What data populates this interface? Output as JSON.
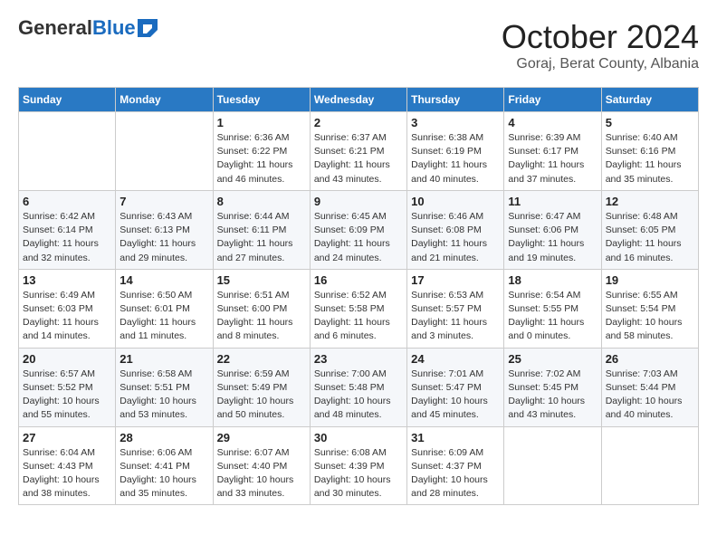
{
  "header": {
    "logo_general": "General",
    "logo_blue": "Blue",
    "month": "October 2024",
    "location": "Goraj, Berat County, Albania"
  },
  "weekdays": [
    "Sunday",
    "Monday",
    "Tuesday",
    "Wednesday",
    "Thursday",
    "Friday",
    "Saturday"
  ],
  "weeks": [
    [
      {
        "day": "",
        "info": ""
      },
      {
        "day": "",
        "info": ""
      },
      {
        "day": "1",
        "info": "Sunrise: 6:36 AM\nSunset: 6:22 PM\nDaylight: 11 hours and 46 minutes."
      },
      {
        "day": "2",
        "info": "Sunrise: 6:37 AM\nSunset: 6:21 PM\nDaylight: 11 hours and 43 minutes."
      },
      {
        "day": "3",
        "info": "Sunrise: 6:38 AM\nSunset: 6:19 PM\nDaylight: 11 hours and 40 minutes."
      },
      {
        "day": "4",
        "info": "Sunrise: 6:39 AM\nSunset: 6:17 PM\nDaylight: 11 hours and 37 minutes."
      },
      {
        "day": "5",
        "info": "Sunrise: 6:40 AM\nSunset: 6:16 PM\nDaylight: 11 hours and 35 minutes."
      }
    ],
    [
      {
        "day": "6",
        "info": "Sunrise: 6:42 AM\nSunset: 6:14 PM\nDaylight: 11 hours and 32 minutes."
      },
      {
        "day": "7",
        "info": "Sunrise: 6:43 AM\nSunset: 6:13 PM\nDaylight: 11 hours and 29 minutes."
      },
      {
        "day": "8",
        "info": "Sunrise: 6:44 AM\nSunset: 6:11 PM\nDaylight: 11 hours and 27 minutes."
      },
      {
        "day": "9",
        "info": "Sunrise: 6:45 AM\nSunset: 6:09 PM\nDaylight: 11 hours and 24 minutes."
      },
      {
        "day": "10",
        "info": "Sunrise: 6:46 AM\nSunset: 6:08 PM\nDaylight: 11 hours and 21 minutes."
      },
      {
        "day": "11",
        "info": "Sunrise: 6:47 AM\nSunset: 6:06 PM\nDaylight: 11 hours and 19 minutes."
      },
      {
        "day": "12",
        "info": "Sunrise: 6:48 AM\nSunset: 6:05 PM\nDaylight: 11 hours and 16 minutes."
      }
    ],
    [
      {
        "day": "13",
        "info": "Sunrise: 6:49 AM\nSunset: 6:03 PM\nDaylight: 11 hours and 14 minutes."
      },
      {
        "day": "14",
        "info": "Sunrise: 6:50 AM\nSunset: 6:01 PM\nDaylight: 11 hours and 11 minutes."
      },
      {
        "day": "15",
        "info": "Sunrise: 6:51 AM\nSunset: 6:00 PM\nDaylight: 11 hours and 8 minutes."
      },
      {
        "day": "16",
        "info": "Sunrise: 6:52 AM\nSunset: 5:58 PM\nDaylight: 11 hours and 6 minutes."
      },
      {
        "day": "17",
        "info": "Sunrise: 6:53 AM\nSunset: 5:57 PM\nDaylight: 11 hours and 3 minutes."
      },
      {
        "day": "18",
        "info": "Sunrise: 6:54 AM\nSunset: 5:55 PM\nDaylight: 11 hours and 0 minutes."
      },
      {
        "day": "19",
        "info": "Sunrise: 6:55 AM\nSunset: 5:54 PM\nDaylight: 10 hours and 58 minutes."
      }
    ],
    [
      {
        "day": "20",
        "info": "Sunrise: 6:57 AM\nSunset: 5:52 PM\nDaylight: 10 hours and 55 minutes."
      },
      {
        "day": "21",
        "info": "Sunrise: 6:58 AM\nSunset: 5:51 PM\nDaylight: 10 hours and 53 minutes."
      },
      {
        "day": "22",
        "info": "Sunrise: 6:59 AM\nSunset: 5:49 PM\nDaylight: 10 hours and 50 minutes."
      },
      {
        "day": "23",
        "info": "Sunrise: 7:00 AM\nSunset: 5:48 PM\nDaylight: 10 hours and 48 minutes."
      },
      {
        "day": "24",
        "info": "Sunrise: 7:01 AM\nSunset: 5:47 PM\nDaylight: 10 hours and 45 minutes."
      },
      {
        "day": "25",
        "info": "Sunrise: 7:02 AM\nSunset: 5:45 PM\nDaylight: 10 hours and 43 minutes."
      },
      {
        "day": "26",
        "info": "Sunrise: 7:03 AM\nSunset: 5:44 PM\nDaylight: 10 hours and 40 minutes."
      }
    ],
    [
      {
        "day": "27",
        "info": "Sunrise: 6:04 AM\nSunset: 4:43 PM\nDaylight: 10 hours and 38 minutes."
      },
      {
        "day": "28",
        "info": "Sunrise: 6:06 AM\nSunset: 4:41 PM\nDaylight: 10 hours and 35 minutes."
      },
      {
        "day": "29",
        "info": "Sunrise: 6:07 AM\nSunset: 4:40 PM\nDaylight: 10 hours and 33 minutes."
      },
      {
        "day": "30",
        "info": "Sunrise: 6:08 AM\nSunset: 4:39 PM\nDaylight: 10 hours and 30 minutes."
      },
      {
        "day": "31",
        "info": "Sunrise: 6:09 AM\nSunset: 4:37 PM\nDaylight: 10 hours and 28 minutes."
      },
      {
        "day": "",
        "info": ""
      },
      {
        "day": "",
        "info": ""
      }
    ]
  ]
}
